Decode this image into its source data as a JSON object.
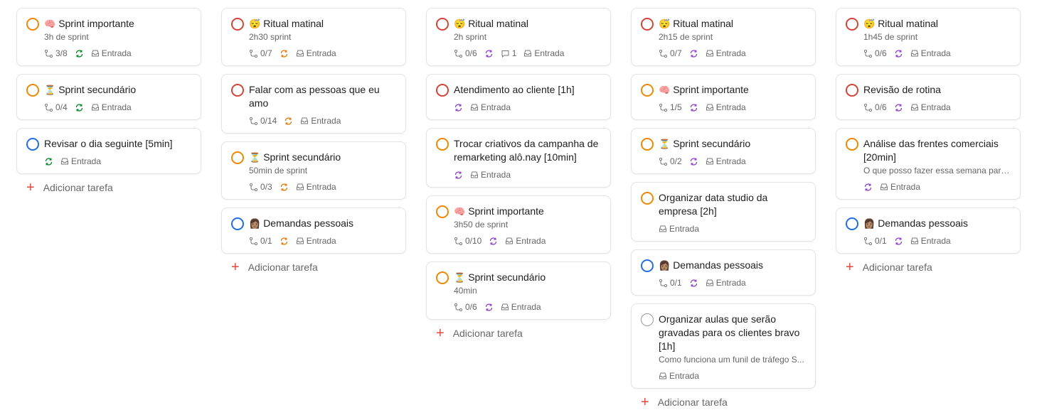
{
  "add_task_label": "Adicionar tarefa",
  "colors": {
    "p1": "#d1453b",
    "p2": "#eb8909",
    "p3": "#246fe0",
    "p4": "#999999",
    "repeat_green": "#058527",
    "repeat_orange": "#e07a0b",
    "repeat_purple": "#8a44c8"
  },
  "columns": [
    {
      "cards": [
        {
          "priority": "p2",
          "emoji": "🧠",
          "title": "Sprint importante",
          "desc": "3h de sprint",
          "subtasks": "3/8",
          "repeat": "green",
          "comments": "",
          "project": "Entrada"
        },
        {
          "priority": "p2",
          "emoji": "⏳",
          "title": "Sprint secundário",
          "desc": "",
          "subtasks": "0/4",
          "repeat": "green",
          "comments": "",
          "project": "Entrada"
        },
        {
          "priority": "p3",
          "emoji": "",
          "title": "Revisar o dia seguinte [5min]",
          "desc": "",
          "subtasks": "",
          "repeat": "green",
          "comments": "",
          "project": "Entrada"
        }
      ]
    },
    {
      "cards": [
        {
          "priority": "p1",
          "emoji": "😴",
          "title": "Ritual matinal",
          "desc": "2h30 sprint",
          "subtasks": "0/7",
          "repeat": "orange",
          "comments": "",
          "project": "Entrada"
        },
        {
          "priority": "p1",
          "emoji": "",
          "title": "Falar com as pessoas que eu amo",
          "desc": "",
          "subtasks": "0/14",
          "repeat": "orange",
          "comments": "",
          "project": "Entrada"
        },
        {
          "priority": "p2",
          "emoji": "⏳",
          "title": "Sprint secundário",
          "desc": "50min de sprint",
          "subtasks": "0/3",
          "repeat": "orange",
          "comments": "",
          "project": "Entrada"
        },
        {
          "priority": "p3",
          "emoji": "👩🏽",
          "title": "Demandas pessoais",
          "desc": "",
          "subtasks": "0/1",
          "repeat": "orange",
          "comments": "",
          "project": "Entrada"
        }
      ]
    },
    {
      "cards": [
        {
          "priority": "p1",
          "emoji": "😴",
          "title": "Ritual matinal",
          "desc": "2h sprint",
          "subtasks": "0/6",
          "repeat": "purple",
          "comments": "1",
          "project": "Entrada"
        },
        {
          "priority": "p1",
          "emoji": "",
          "title": "Atendimento ao cliente [1h]",
          "desc": "",
          "subtasks": "",
          "repeat": "purple",
          "comments": "",
          "project": "Entrada"
        },
        {
          "priority": "p2",
          "emoji": "",
          "title": "Trocar criativos da campanha de remarketing alô.nay [10min]",
          "desc": "",
          "subtasks": "",
          "repeat": "purple",
          "comments": "",
          "project": "Entrada"
        },
        {
          "priority": "p2",
          "emoji": "🧠",
          "title": "Sprint importante",
          "desc": "3h50 de sprint",
          "subtasks": "0/10",
          "repeat": "purple",
          "comments": "",
          "project": "Entrada"
        },
        {
          "priority": "p2",
          "emoji": "⏳",
          "title": "Sprint secundário",
          "desc": "40min",
          "subtasks": "0/6",
          "repeat": "purple",
          "comments": "",
          "project": "Entrada"
        }
      ]
    },
    {
      "cards": [
        {
          "priority": "p1",
          "emoji": "😴",
          "title": "Ritual matinal",
          "desc": "2h15 de sprint",
          "subtasks": "0/7",
          "repeat": "purple",
          "comments": "",
          "project": "Entrada"
        },
        {
          "priority": "p2",
          "emoji": "🧠",
          "title": "Sprint importante",
          "desc": "",
          "subtasks": "1/5",
          "repeat": "purple",
          "comments": "",
          "project": "Entrada"
        },
        {
          "priority": "p2",
          "emoji": "⏳",
          "title": "Sprint secundário",
          "desc": "",
          "subtasks": "0/2",
          "repeat": "purple",
          "comments": "",
          "project": "Entrada"
        },
        {
          "priority": "p2",
          "emoji": "",
          "title": "Organizar data studio da empresa [2h]",
          "desc": "",
          "subtasks": "",
          "repeat": "",
          "comments": "",
          "project": "Entrada"
        },
        {
          "priority": "p3",
          "emoji": "👩🏽",
          "title": "Demandas pessoais",
          "desc": "",
          "subtasks": "0/1",
          "repeat": "purple",
          "comments": "",
          "project": "Entrada"
        },
        {
          "priority": "p4",
          "emoji": "",
          "title": "Organizar aulas que serão gravadas para os clientes bravo [1h]",
          "desc": "Como funciona um funil de tráfego S...",
          "subtasks": "",
          "repeat": "",
          "comments": "",
          "project": "Entrada"
        }
      ]
    },
    {
      "cards": [
        {
          "priority": "p1",
          "emoji": "😴",
          "title": "Ritual matinal",
          "desc": "1h45 de sprint",
          "subtasks": "0/6",
          "repeat": "purple",
          "comments": "",
          "project": "Entrada"
        },
        {
          "priority": "p1",
          "emoji": "",
          "title": "Revisão de rotina",
          "desc": "",
          "subtasks": "0/6",
          "repeat": "purple",
          "comments": "",
          "project": "Entrada"
        },
        {
          "priority": "p2",
          "emoji": "",
          "title": "Análise das frentes comerciais [20min]",
          "desc": "O que posso fazer essa semana para f...",
          "subtasks": "",
          "repeat": "purple",
          "comments": "",
          "project": "Entrada"
        },
        {
          "priority": "p3",
          "emoji": "👩🏽",
          "title": "Demandas pessoais",
          "desc": "",
          "subtasks": "0/1",
          "repeat": "purple",
          "comments": "",
          "project": "Entrada"
        }
      ]
    }
  ]
}
